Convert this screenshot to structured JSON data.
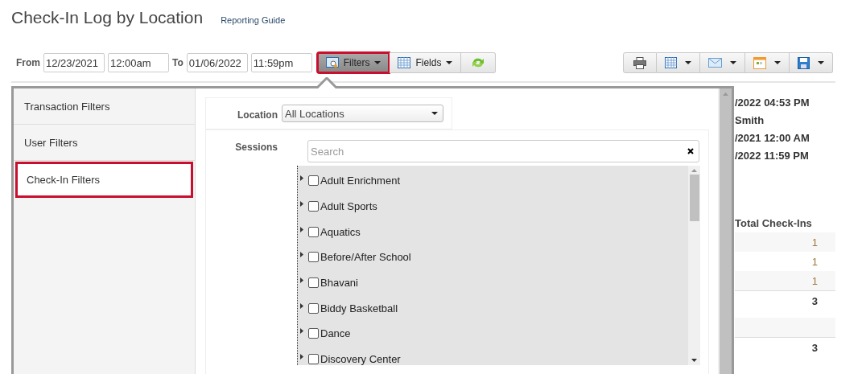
{
  "title": "Check-In Log by Location",
  "guide_link": "Reporting Guide",
  "date_range": {
    "from_label": "From",
    "from_date": "12/23/2021",
    "from_time": "12:00am",
    "to_label": "To",
    "to_date": "01/06/2022",
    "to_time": "11:59pm"
  },
  "toolbar": [
    {
      "kind": "filters",
      "label": "Filters",
      "selected": true
    },
    {
      "kind": "fields",
      "label": "Fields",
      "selected": false
    },
    {
      "kind": "refresh",
      "selected": false
    }
  ],
  "export_toolbar": [
    {
      "kind": "print"
    },
    {
      "kind": "grid"
    },
    {
      "kind": "mail"
    },
    {
      "kind": "calendar"
    },
    {
      "kind": "save"
    }
  ],
  "filter_panel": {
    "categories": [
      {
        "label": "Transaction Filters",
        "selected": false
      },
      {
        "label": "User Filters",
        "selected": false
      },
      {
        "label": "Check-In Filters",
        "selected": true
      }
    ],
    "location_label": "Location",
    "location_value": "All Locations",
    "sessions_label": "Sessions",
    "search_placeholder": "Search",
    "sessions": [
      {
        "label": "Adult Enrichment",
        "checked": false
      },
      {
        "label": "Adult Sports",
        "checked": false
      },
      {
        "label": "Aquatics",
        "checked": false
      },
      {
        "label": "Before/After School",
        "checked": false
      },
      {
        "label": "Bhavani",
        "checked": false
      },
      {
        "label": "Biddy Basketball",
        "checked": false
      },
      {
        "label": "Dance",
        "checked": false
      },
      {
        "label": "Discovery Center",
        "checked": false
      }
    ]
  },
  "report": {
    "header_lines": [
      "/2022 04:53 PM",
      "Smith",
      "/2021 12:00 AM",
      "/2022 11:59 PM"
    ],
    "column_heading": "Total Check-Ins",
    "rows": [
      {
        "kind": "row",
        "value": "1"
      },
      {
        "kind": "row",
        "value": "1"
      },
      {
        "kind": "row",
        "value": "1"
      },
      {
        "kind": "total",
        "value": "3"
      },
      {
        "kind": "blank"
      },
      {
        "kind": "total",
        "value": "3"
      }
    ]
  }
}
